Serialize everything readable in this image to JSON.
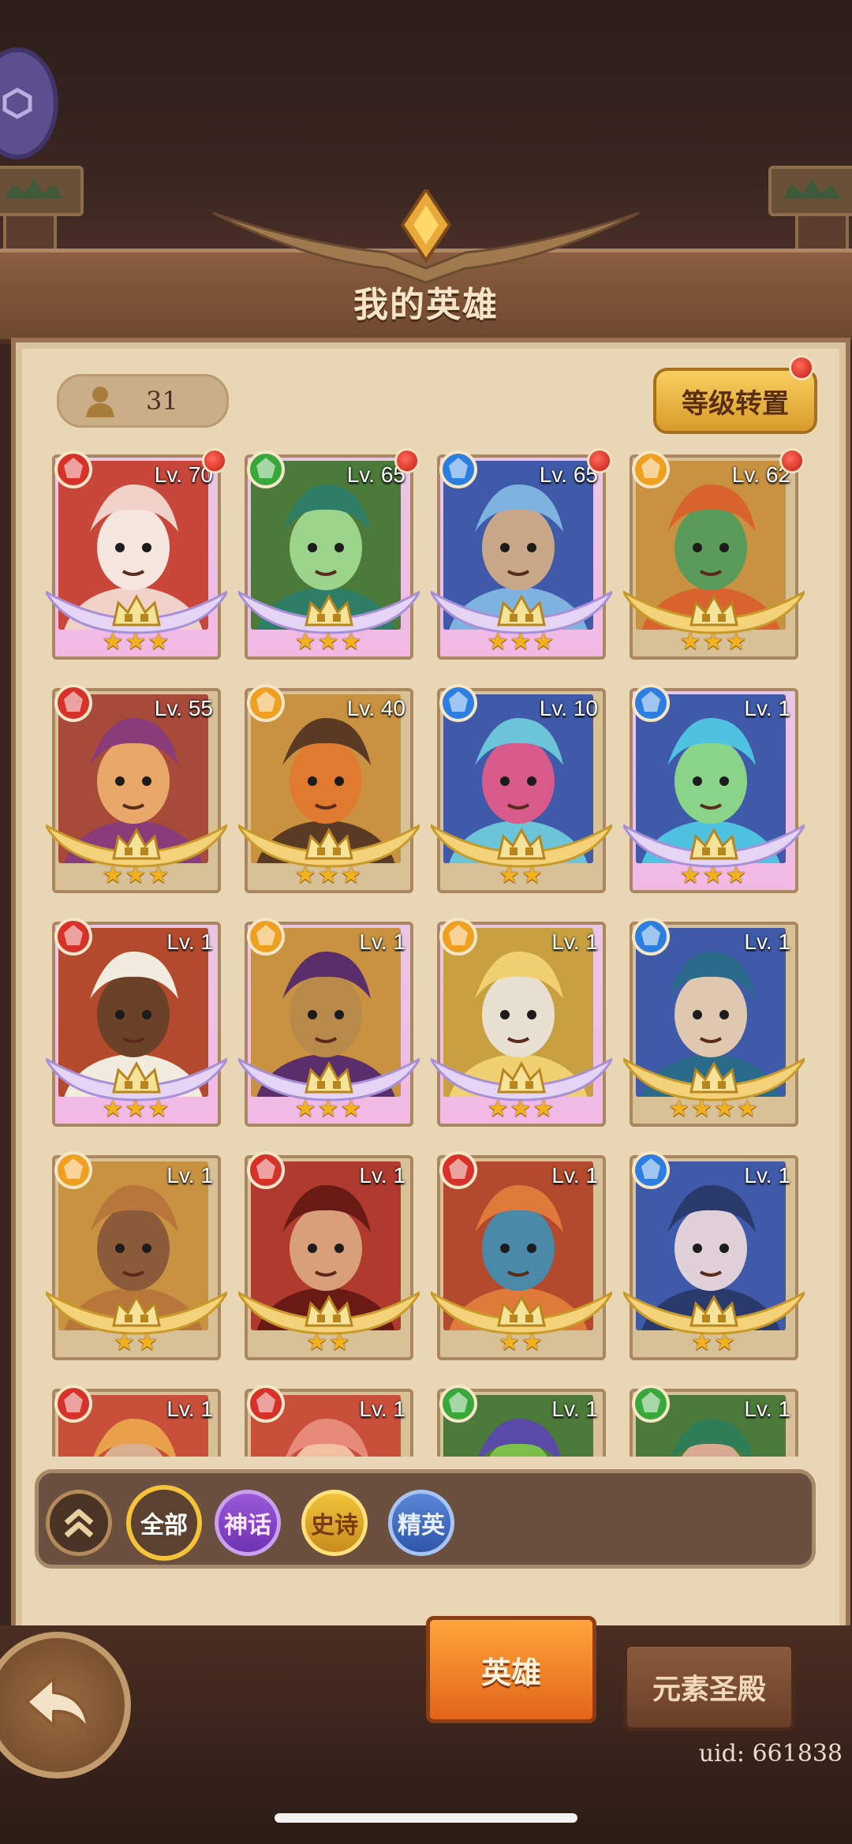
{
  "header": {
    "title": "我的英雄"
  },
  "hero_count": {
    "value": "31",
    "icon": "person-icon"
  },
  "transfer_button": {
    "label": "等级转置",
    "has_notification": true
  },
  "colors": {
    "fire": "#d6322a",
    "nature": "#39a83a",
    "water": "#2c7fe0",
    "light": "#f0a020",
    "mythic": "#f2b9e4",
    "gold": "#e8b53a"
  },
  "heroes": [
    {
      "level": "Lv. 70",
      "element": "fire",
      "tier": "mythic",
      "stars": "★★★",
      "notify": true,
      "palette": [
        "#c9463a",
        "#f1d2c8",
        "#f5e6e0"
      ]
    },
    {
      "level": "Lv. 65",
      "element": "nature",
      "tier": "mythic",
      "stars": "★★★",
      "notify": true,
      "palette": [
        "#4b7a3a",
        "#2e7d66",
        "#9bd48a"
      ]
    },
    {
      "level": "Lv. 65",
      "element": "water",
      "tier": "mythic",
      "stars": "★★★",
      "notify": true,
      "palette": [
        "#3f5aa8",
        "#7fb3df",
        "#c8a888"
      ]
    },
    {
      "level": "Lv. 62",
      "element": "light",
      "tier": "epic",
      "stars": "★★★",
      "notify": true,
      "palette": [
        "#c89240",
        "#d9632f",
        "#5a9a5a"
      ]
    },
    {
      "level": "Lv. 55",
      "element": "fire",
      "tier": "epic",
      "stars": "★★★",
      "notify": false,
      "palette": [
        "#a84a3a",
        "#8a3c7a",
        "#e8a86a"
      ]
    },
    {
      "level": "Lv. 40",
      "element": "light",
      "tier": "epic",
      "stars": "★★★",
      "notify": false,
      "palette": [
        "#c89240",
        "#5a3a24",
        "#e07a30"
      ]
    },
    {
      "level": "Lv. 10",
      "element": "water",
      "tier": "epic",
      "stars": "★★",
      "notify": false,
      "palette": [
        "#3f5aa8",
        "#6cc4d8",
        "#d85a8a"
      ]
    },
    {
      "level": "Lv. 1",
      "element": "water",
      "tier": "mythic",
      "stars": "★★★",
      "notify": false,
      "palette": [
        "#3f5aa8",
        "#4ec2e0",
        "#8ad48a"
      ]
    },
    {
      "level": "Lv. 1",
      "element": "fire",
      "tier": "mythic",
      "stars": "★★★",
      "notify": false,
      "palette": [
        "#b34a2e",
        "#f2ecdf",
        "#6a4228"
      ]
    },
    {
      "level": "Lv. 1",
      "element": "light",
      "tier": "mythic",
      "stars": "★★★",
      "notify": false,
      "palette": [
        "#c89240",
        "#5a2e6a",
        "#b88a4a"
      ]
    },
    {
      "level": "Lv. 1",
      "element": "light",
      "tier": "mythic",
      "stars": "★★★",
      "notify": false,
      "palette": [
        "#c8a040",
        "#f0d070",
        "#e8e0d0"
      ]
    },
    {
      "level": "Lv. 1",
      "element": "water",
      "tier": "epic",
      "stars": "★★★★",
      "notify": false,
      "palette": [
        "#3f5aa8",
        "#2a6a8a",
        "#e0c8b0"
      ]
    },
    {
      "level": "Lv. 1",
      "element": "light",
      "tier": "epic",
      "stars": "★★",
      "notify": false,
      "palette": [
        "#c89240",
        "#b8763a",
        "#8a5a3a"
      ]
    },
    {
      "level": "Lv. 1",
      "element": "fire",
      "tier": "epic",
      "stars": "★★",
      "notify": false,
      "palette": [
        "#b03a2e",
        "#6a1a14",
        "#d8a07a"
      ]
    },
    {
      "level": "Lv. 1",
      "element": "fire",
      "tier": "epic",
      "stars": "★★",
      "notify": false,
      "palette": [
        "#b34a2e",
        "#e07a3a",
        "#4a8aa8"
      ]
    },
    {
      "level": "Lv. 1",
      "element": "water",
      "tier": "epic",
      "stars": "★★",
      "notify": false,
      "palette": [
        "#3f5aa8",
        "#2a3a6a",
        "#e0d0d8"
      ]
    },
    {
      "level": "Lv. 1",
      "element": "fire",
      "tier": "epic",
      "stars": "",
      "notify": false,
      "palette": [
        "#c8503a",
        "#e8a04a",
        "#d8b090"
      ]
    },
    {
      "level": "Lv. 1",
      "element": "fire",
      "tier": "epic",
      "stars": "",
      "notify": false,
      "palette": [
        "#c8503a",
        "#e88a7a",
        "#f0c0a0"
      ]
    },
    {
      "level": "Lv. 1",
      "element": "nature",
      "tier": "epic",
      "stars": "",
      "notify": false,
      "palette": [
        "#4b7a3a",
        "#5a4aa8",
        "#7ac04a"
      ]
    },
    {
      "level": "Lv. 1",
      "element": "nature",
      "tier": "epic",
      "stars": "",
      "notify": false,
      "palette": [
        "#4b7a3a",
        "#2e7d56",
        "#d8a890"
      ]
    }
  ],
  "filters": {
    "collapse_icon": "double-chevron-up-icon",
    "all": "全部",
    "mythic": "神话",
    "epic": "史诗",
    "elite": "精英"
  },
  "bottom_tabs": {
    "heroes": "英雄",
    "temple": "元素圣殿"
  },
  "back_icon": "back-arrow-icon",
  "uid": "uid: 661838"
}
